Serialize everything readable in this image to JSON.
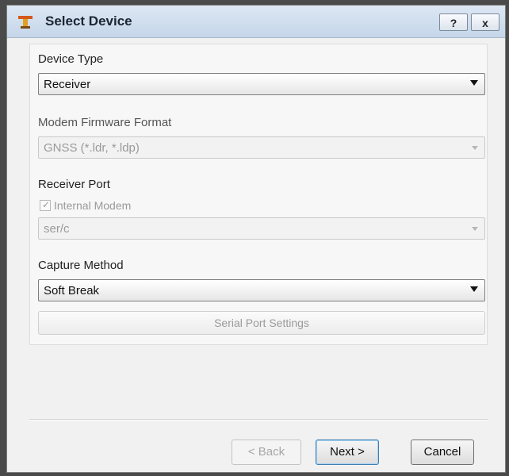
{
  "window": {
    "title": "Select Device"
  },
  "titlebar": {
    "help_label": "?",
    "close_label": "x"
  },
  "device_type": {
    "label": "Device Type",
    "value": "Receiver"
  },
  "modem_firmware": {
    "label": "Modem Firmware Format",
    "value": "GNSS (*.ldr, *.ldp)"
  },
  "receiver_port": {
    "label": "Receiver Port",
    "internal_modem_label": "Internal Modem",
    "internal_modem_checked": true,
    "port_value": "ser/c"
  },
  "capture_method": {
    "label": "Capture Method",
    "value": "Soft Break"
  },
  "serial_port_settings": {
    "label": "Serial Port Settings"
  },
  "footer": {
    "back_label": "< Back",
    "next_label": "Next >",
    "cancel_label": "Cancel"
  }
}
